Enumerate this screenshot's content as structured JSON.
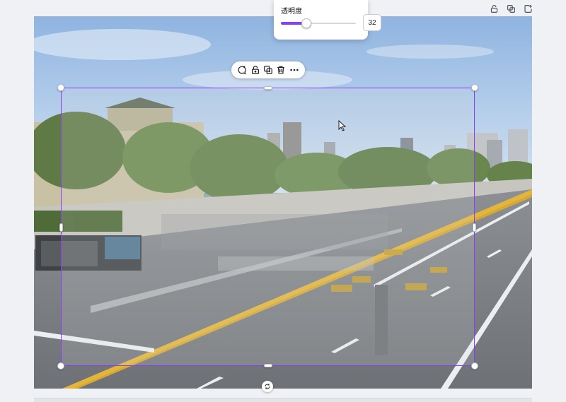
{
  "page_actions": [
    {
      "name": "lock-page-button",
      "icon": "lock-icon"
    },
    {
      "name": "duplicate-page-button",
      "icon": "duplicate-icon"
    },
    {
      "name": "add-page-button",
      "icon": "add-page-icon"
    }
  ],
  "transparency": {
    "label": "透明度",
    "value": "32",
    "level": 0.32
  },
  "toolbar": [
    {
      "name": "comment-button",
      "icon": "comment-plus-icon"
    },
    {
      "name": "lock-button",
      "icon": "lock-icon"
    },
    {
      "name": "duplicate-button",
      "icon": "duplicate-icon"
    },
    {
      "name": "delete-button",
      "icon": "trash-icon"
    },
    {
      "name": "more-button",
      "icon": "more-horizontal-icon"
    }
  ],
  "colors": {
    "accent": "#8b3dff",
    "sky": "#a9c6e8",
    "road": "#7b7e82",
    "lane_yellow": "#e3b53a"
  }
}
